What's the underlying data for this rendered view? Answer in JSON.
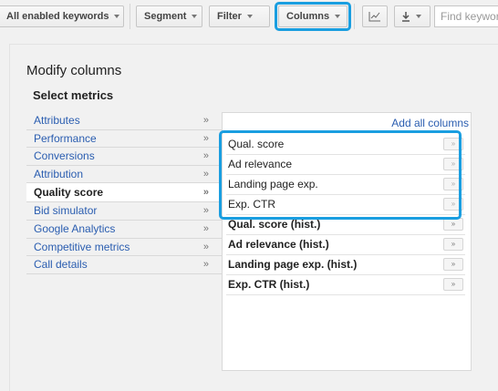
{
  "toolbar": {
    "keywords_filter": "All enabled keywords",
    "segment": "Segment",
    "filter": "Filter",
    "columns": "Columns",
    "chart_icon": "line-chart-icon",
    "download_icon": "download-icon",
    "search_placeholder": "Find keywords"
  },
  "panel": {
    "title": "Modify columns",
    "subtitle": "Select metrics",
    "arrow_glyph": "»",
    "categories": [
      "Attributes",
      "Performance",
      "Conversions",
      "Attribution",
      "Quality score",
      "Bid simulator",
      "Google Analytics",
      "Competitive metrics",
      "Call details"
    ],
    "selected_category": "Quality score",
    "add_all": "Add all columns",
    "add_glyph": "»",
    "metrics": [
      "Qual. score",
      "Ad relevance",
      "Landing page exp.",
      "Exp. CTR",
      "Qual. score (hist.)",
      "Ad relevance (hist.)",
      "Landing page exp. (hist.)",
      "Exp. CTR (hist.)"
    ]
  },
  "colors": {
    "highlight": "#1a9ee0",
    "link": "#2a5db0"
  }
}
